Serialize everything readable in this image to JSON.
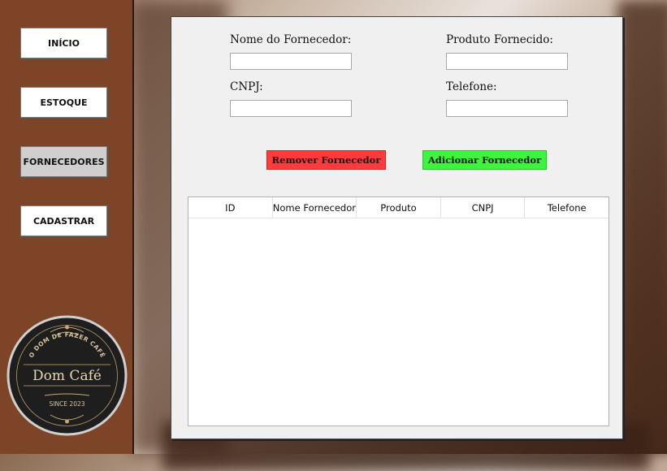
{
  "sidebar": {
    "items": [
      {
        "label": "INÍCIO",
        "active": false
      },
      {
        "label": "ESTOQUE",
        "active": false
      },
      {
        "label": "FORNECEDORES",
        "active": true
      },
      {
        "label": "CADASTRAR",
        "active": false
      }
    ],
    "logo": {
      "arc_text": "O DOM DE FAZER CAFÉ",
      "name": "Dom Café",
      "since": "SINCE 2023"
    }
  },
  "form": {
    "supplier_name": {
      "label": "Nome do Fornecedor:",
      "value": ""
    },
    "product": {
      "label": "Produto Fornecido:",
      "value": ""
    },
    "cnpj": {
      "label": "CNPJ:",
      "value": ""
    },
    "phone": {
      "label": "Telefone:",
      "value": ""
    }
  },
  "actions": {
    "remove_label": "Remover Fornecedor",
    "add_label": "Adicionar Fornecedor",
    "remove_color": "#ff3b3b",
    "add_color": "#3cf53c"
  },
  "table": {
    "columns": [
      "ID",
      "Nome Fornecedor",
      "Produto",
      "CNPJ",
      "Telefone"
    ],
    "rows": []
  }
}
